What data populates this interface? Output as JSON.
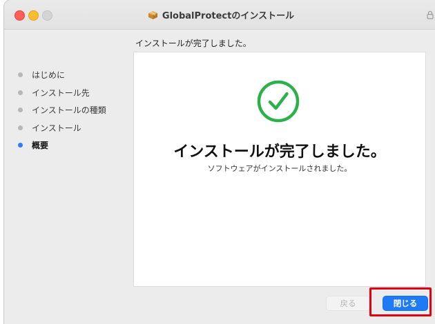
{
  "window": {
    "title": "GlobalProtectのインストール",
    "icons": {
      "package": "package-icon",
      "lock": "lock-icon"
    }
  },
  "header": {
    "subtitle": "インストールが完了しました。"
  },
  "sidebar": {
    "steps": [
      {
        "label": "はじめに",
        "active": false
      },
      {
        "label": "インストール先",
        "active": false
      },
      {
        "label": "インストールの種類",
        "active": false
      },
      {
        "label": "インストール",
        "active": false
      },
      {
        "label": "概要",
        "active": true
      }
    ]
  },
  "main": {
    "icon": "checkmark-circle-icon",
    "heading": "インストールが完了しました。",
    "message": "ソフトウェアがインストールされました。"
  },
  "footer": {
    "back_label": "戻る",
    "close_label": "閉じる"
  },
  "colors": {
    "accent": "#1e7bf5",
    "success": "#2bb14a",
    "highlight": "#e3000f"
  }
}
